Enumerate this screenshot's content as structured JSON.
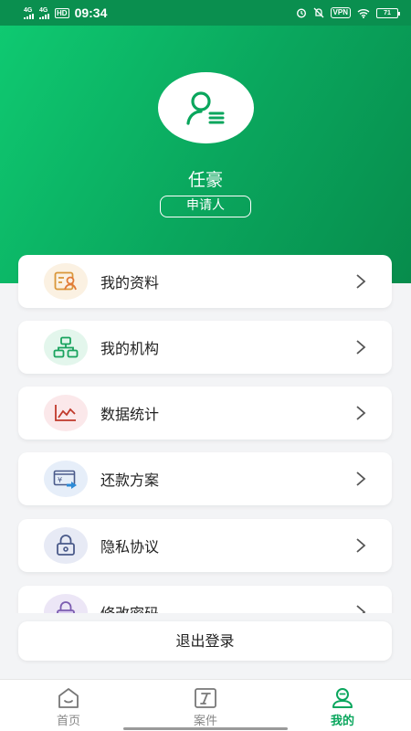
{
  "status": {
    "network1": "4G",
    "network2": "4G",
    "hd": "HD",
    "time": "09:34",
    "vpn": "VPN",
    "battery": "71"
  },
  "profile": {
    "name": "任豪",
    "role": "申请人"
  },
  "menu": [
    {
      "label": "我的资料",
      "icon": "profile-card-icon",
      "icon_bg": "#fbf1e2",
      "icon_color": "#d9973a"
    },
    {
      "label": "我的机构",
      "icon": "organization-icon",
      "icon_bg": "#e3f6ec",
      "icon_color": "#19a35e"
    },
    {
      "label": "数据统计",
      "icon": "line-chart-icon",
      "icon_bg": "#fbe8ea",
      "icon_color": "#c0392b"
    },
    {
      "label": "还款方案",
      "icon": "repayment-plan-icon",
      "icon_bg": "#e6eef9",
      "icon_color": "#3b6fb6"
    },
    {
      "label": "隐私协议",
      "icon": "lock-icon",
      "icon_bg": "#e7eaf5",
      "icon_color": "#4a5a8a"
    },
    {
      "label": "修改密码",
      "icon": "password-lock-icon",
      "icon_bg": "#ece6f6",
      "icon_color": "#7b5cb0"
    }
  ],
  "logout_label": "退出登录",
  "tabs": [
    {
      "label": "首页",
      "icon": "home-icon",
      "active": false
    },
    {
      "label": "案件",
      "icon": "case-icon",
      "active": false
    },
    {
      "label": "我的",
      "icon": "user-icon",
      "active": true
    }
  ],
  "colors": {
    "brand": "#0aa65d",
    "brand_light": "#0fcb72"
  }
}
